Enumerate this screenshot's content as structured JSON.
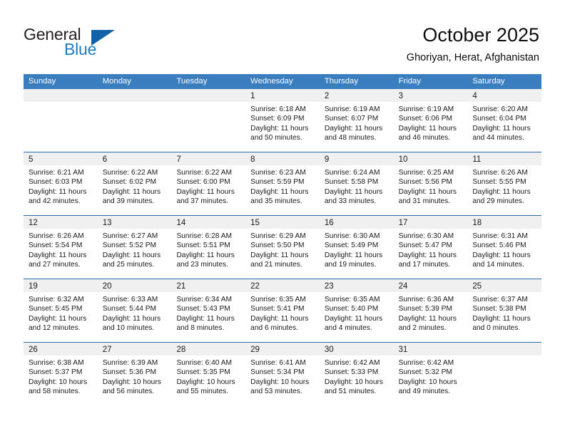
{
  "brand": {
    "name_part1": "General",
    "name_part2": "Blue",
    "triangle_icon": "triangle-logo-icon",
    "color_dark": "#231f20",
    "color_blue": "#1f7bc1"
  },
  "header": {
    "title": "October 2025",
    "subtitle": "Ghoriyan, Herat, Afghanistan"
  },
  "theme": {
    "header_row_bg": "#3a7ec0",
    "week_divider": "#2d6ca8",
    "cell_head_bg": "#f0f0f0"
  },
  "calendar": {
    "day_headers": [
      "Sunday",
      "Monday",
      "Tuesday",
      "Wednesday",
      "Thursday",
      "Friday",
      "Saturday"
    ],
    "weeks": [
      [
        {
          "day": "",
          "lines": []
        },
        {
          "day": "",
          "lines": []
        },
        {
          "day": "",
          "lines": []
        },
        {
          "day": "1",
          "lines": [
            "Sunrise: 6:18 AM",
            "Sunset: 6:09 PM",
            "Daylight: 11 hours",
            "and 50 minutes."
          ]
        },
        {
          "day": "2",
          "lines": [
            "Sunrise: 6:19 AM",
            "Sunset: 6:07 PM",
            "Daylight: 11 hours",
            "and 48 minutes."
          ]
        },
        {
          "day": "3",
          "lines": [
            "Sunrise: 6:19 AM",
            "Sunset: 6:06 PM",
            "Daylight: 11 hours",
            "and 46 minutes."
          ]
        },
        {
          "day": "4",
          "lines": [
            "Sunrise: 6:20 AM",
            "Sunset: 6:04 PM",
            "Daylight: 11 hours",
            "and 44 minutes."
          ]
        }
      ],
      [
        {
          "day": "5",
          "lines": [
            "Sunrise: 6:21 AM",
            "Sunset: 6:03 PM",
            "Daylight: 11 hours",
            "and 42 minutes."
          ]
        },
        {
          "day": "6",
          "lines": [
            "Sunrise: 6:22 AM",
            "Sunset: 6:02 PM",
            "Daylight: 11 hours",
            "and 39 minutes."
          ]
        },
        {
          "day": "7",
          "lines": [
            "Sunrise: 6:22 AM",
            "Sunset: 6:00 PM",
            "Daylight: 11 hours",
            "and 37 minutes."
          ]
        },
        {
          "day": "8",
          "lines": [
            "Sunrise: 6:23 AM",
            "Sunset: 5:59 PM",
            "Daylight: 11 hours",
            "and 35 minutes."
          ]
        },
        {
          "day": "9",
          "lines": [
            "Sunrise: 6:24 AM",
            "Sunset: 5:58 PM",
            "Daylight: 11 hours",
            "and 33 minutes."
          ]
        },
        {
          "day": "10",
          "lines": [
            "Sunrise: 6:25 AM",
            "Sunset: 5:56 PM",
            "Daylight: 11 hours",
            "and 31 minutes."
          ]
        },
        {
          "day": "11",
          "lines": [
            "Sunrise: 6:26 AM",
            "Sunset: 5:55 PM",
            "Daylight: 11 hours",
            "and 29 minutes."
          ]
        }
      ],
      [
        {
          "day": "12",
          "lines": [
            "Sunrise: 6:26 AM",
            "Sunset: 5:54 PM",
            "Daylight: 11 hours",
            "and 27 minutes."
          ]
        },
        {
          "day": "13",
          "lines": [
            "Sunrise: 6:27 AM",
            "Sunset: 5:52 PM",
            "Daylight: 11 hours",
            "and 25 minutes."
          ]
        },
        {
          "day": "14",
          "lines": [
            "Sunrise: 6:28 AM",
            "Sunset: 5:51 PM",
            "Daylight: 11 hours",
            "and 23 minutes."
          ]
        },
        {
          "day": "15",
          "lines": [
            "Sunrise: 6:29 AM",
            "Sunset: 5:50 PM",
            "Daylight: 11 hours",
            "and 21 minutes."
          ]
        },
        {
          "day": "16",
          "lines": [
            "Sunrise: 6:30 AM",
            "Sunset: 5:49 PM",
            "Daylight: 11 hours",
            "and 19 minutes."
          ]
        },
        {
          "day": "17",
          "lines": [
            "Sunrise: 6:30 AM",
            "Sunset: 5:47 PM",
            "Daylight: 11 hours",
            "and 17 minutes."
          ]
        },
        {
          "day": "18",
          "lines": [
            "Sunrise: 6:31 AM",
            "Sunset: 5:46 PM",
            "Daylight: 11 hours",
            "and 14 minutes."
          ]
        }
      ],
      [
        {
          "day": "19",
          "lines": [
            "Sunrise: 6:32 AM",
            "Sunset: 5:45 PM",
            "Daylight: 11 hours",
            "and 12 minutes."
          ]
        },
        {
          "day": "20",
          "lines": [
            "Sunrise: 6:33 AM",
            "Sunset: 5:44 PM",
            "Daylight: 11 hours",
            "and 10 minutes."
          ]
        },
        {
          "day": "21",
          "lines": [
            "Sunrise: 6:34 AM",
            "Sunset: 5:43 PM",
            "Daylight: 11 hours",
            "and 8 minutes."
          ]
        },
        {
          "day": "22",
          "lines": [
            "Sunrise: 6:35 AM",
            "Sunset: 5:41 PM",
            "Daylight: 11 hours",
            "and 6 minutes."
          ]
        },
        {
          "day": "23",
          "lines": [
            "Sunrise: 6:35 AM",
            "Sunset: 5:40 PM",
            "Daylight: 11 hours",
            "and 4 minutes."
          ]
        },
        {
          "day": "24",
          "lines": [
            "Sunrise: 6:36 AM",
            "Sunset: 5:39 PM",
            "Daylight: 11 hours",
            "and 2 minutes."
          ]
        },
        {
          "day": "25",
          "lines": [
            "Sunrise: 6:37 AM",
            "Sunset: 5:38 PM",
            "Daylight: 11 hours",
            "and 0 minutes."
          ]
        }
      ],
      [
        {
          "day": "26",
          "lines": [
            "Sunrise: 6:38 AM",
            "Sunset: 5:37 PM",
            "Daylight: 10 hours",
            "and 58 minutes."
          ]
        },
        {
          "day": "27",
          "lines": [
            "Sunrise: 6:39 AM",
            "Sunset: 5:36 PM",
            "Daylight: 10 hours",
            "and 56 minutes."
          ]
        },
        {
          "day": "28",
          "lines": [
            "Sunrise: 6:40 AM",
            "Sunset: 5:35 PM",
            "Daylight: 10 hours",
            "and 55 minutes."
          ]
        },
        {
          "day": "29",
          "lines": [
            "Sunrise: 6:41 AM",
            "Sunset: 5:34 PM",
            "Daylight: 10 hours",
            "and 53 minutes."
          ]
        },
        {
          "day": "30",
          "lines": [
            "Sunrise: 6:42 AM",
            "Sunset: 5:33 PM",
            "Daylight: 10 hours",
            "and 51 minutes."
          ]
        },
        {
          "day": "31",
          "lines": [
            "Sunrise: 6:42 AM",
            "Sunset: 5:32 PM",
            "Daylight: 10 hours",
            "and 49 minutes."
          ]
        },
        {
          "day": "",
          "lines": []
        }
      ]
    ]
  }
}
